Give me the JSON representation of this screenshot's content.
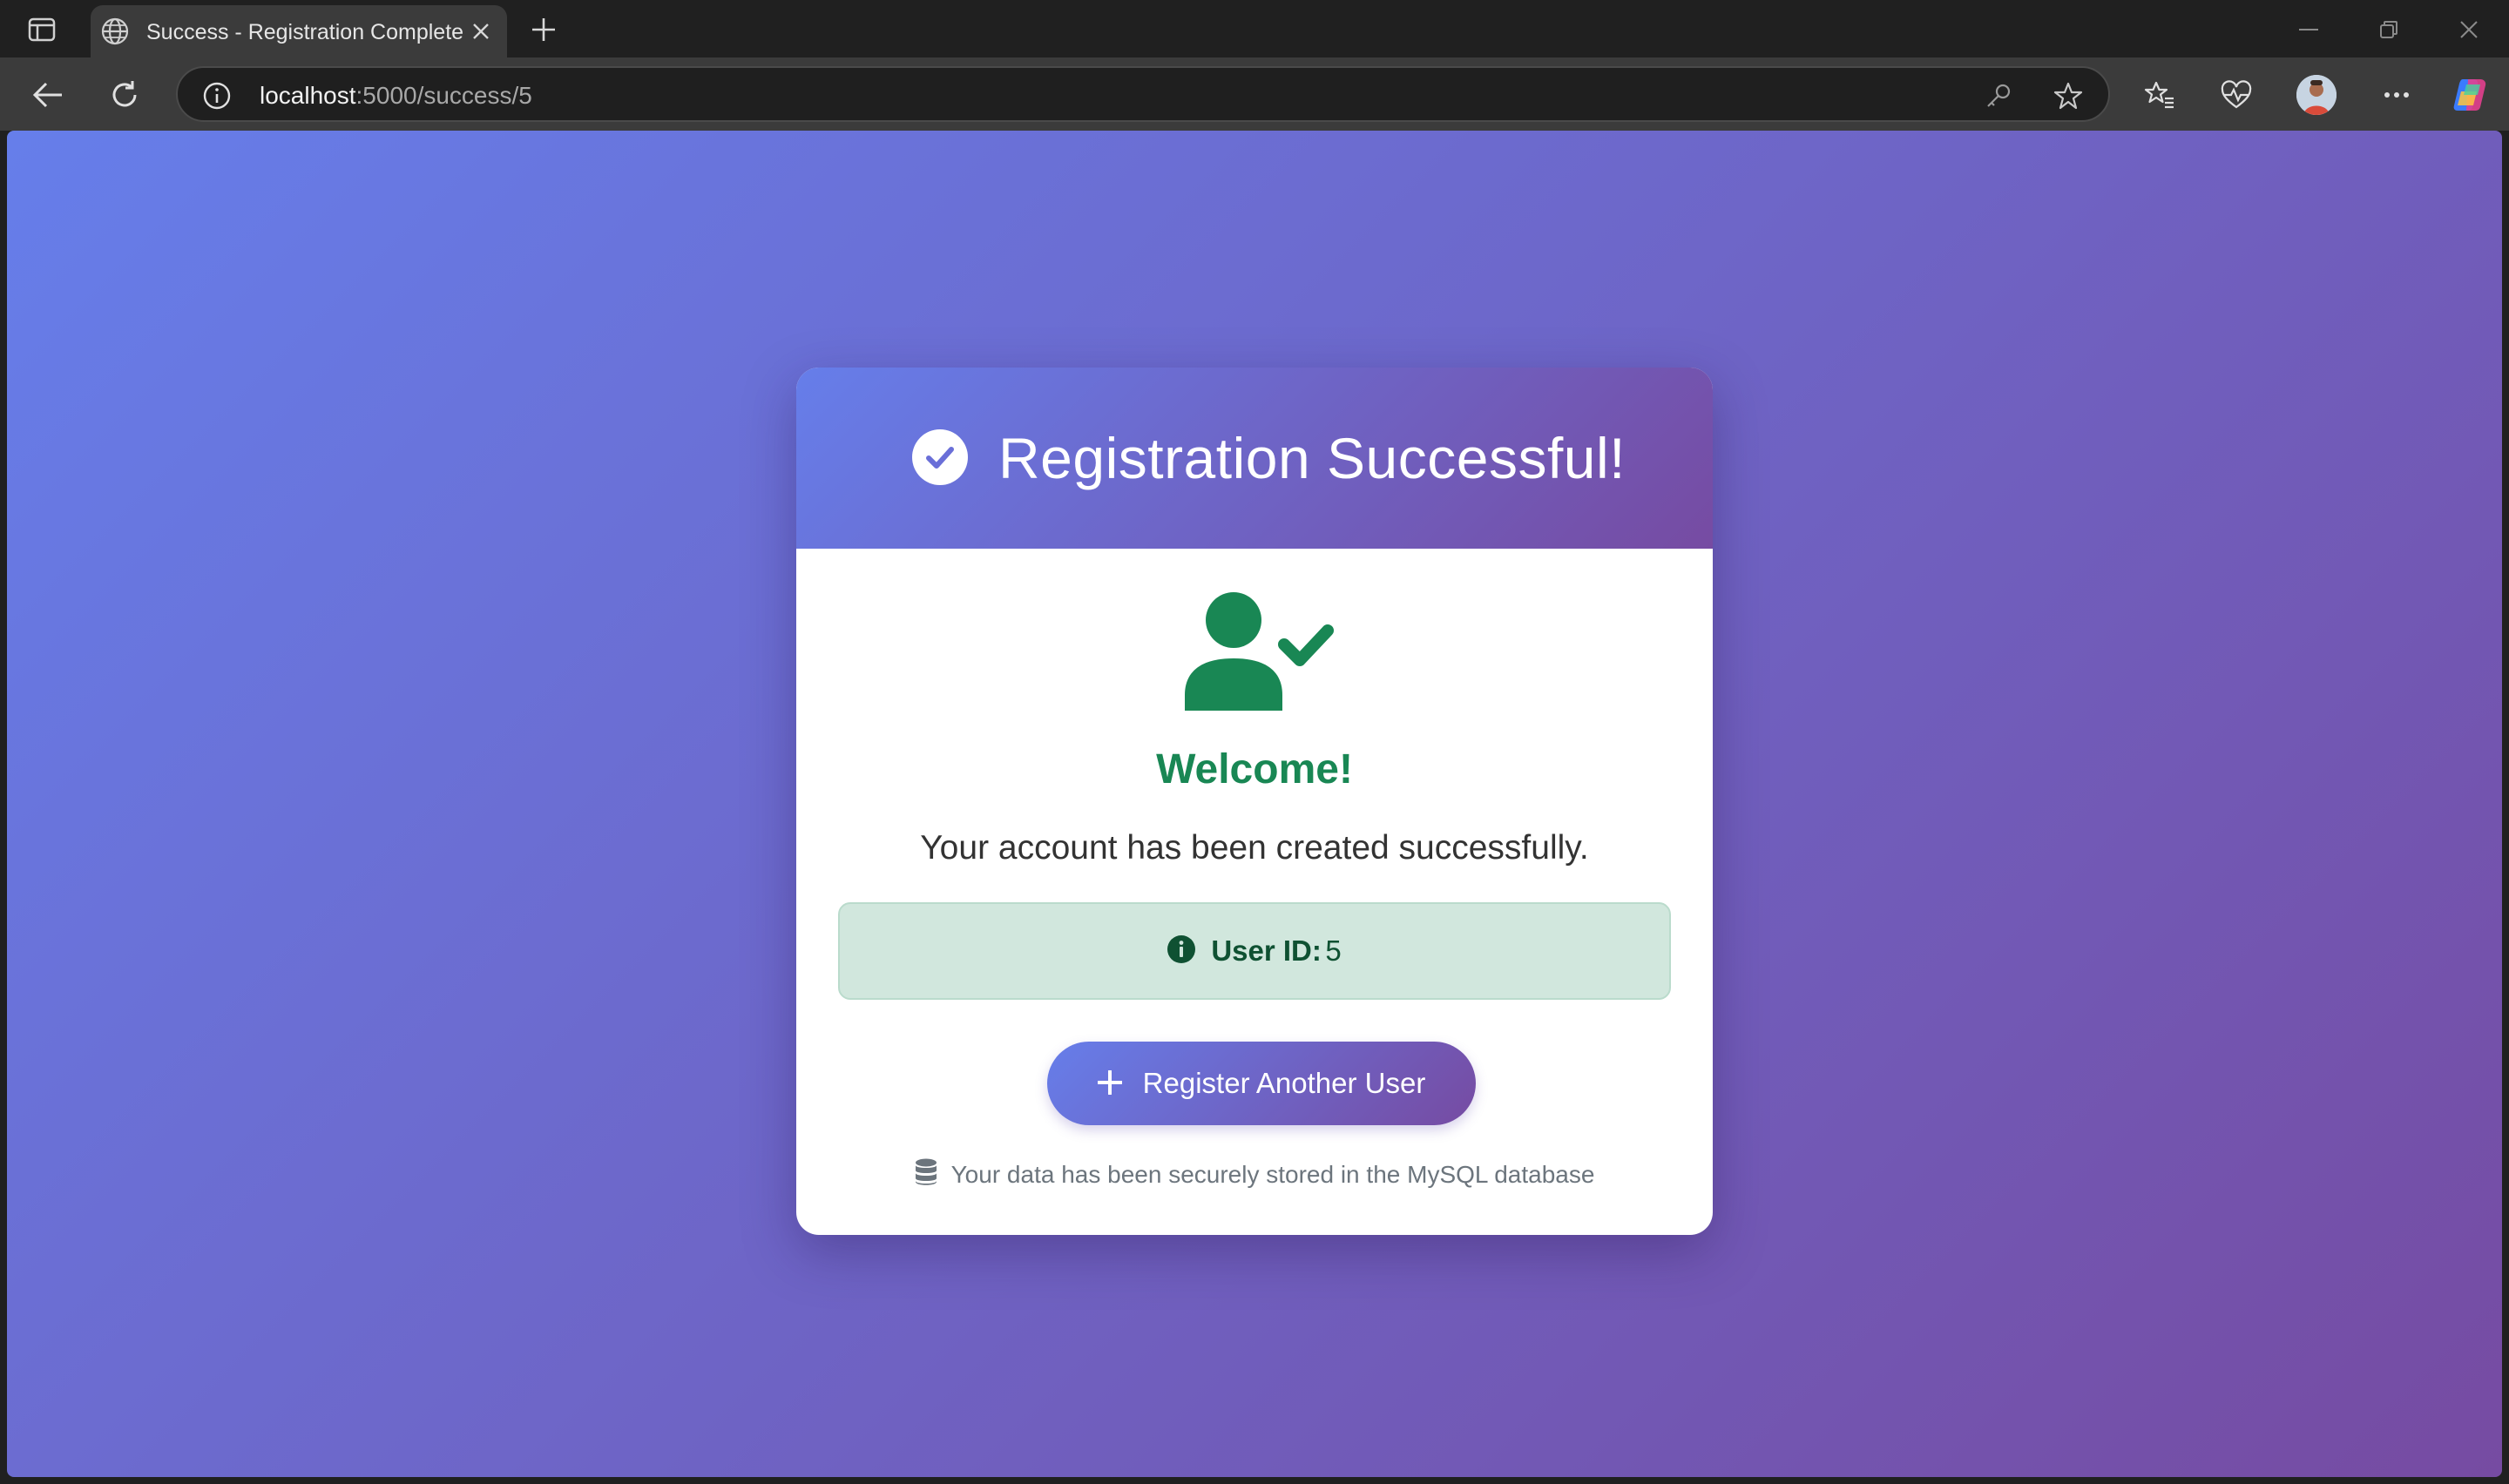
{
  "browser": {
    "tab_title": "Success - Registration Complete",
    "url_host": "localhost",
    "url_path": ":5000/success/5",
    "icons": [
      "sidebar-toggle-icon",
      "globe-icon",
      "close-icon",
      "plus-icon",
      "minimize-icon",
      "restore-icon",
      "window-close-icon",
      "back-arrow-icon",
      "refresh-icon",
      "info-icon",
      "key-icon",
      "star-icon",
      "favorites-icon",
      "heartbeat-icon",
      "avatar",
      "more-icon",
      "copilot-icon"
    ]
  },
  "page": {
    "background_gradient": [
      "#667eea",
      "#764ba2"
    ],
    "card": {
      "title": "Registration Successful!",
      "welcome": "Welcome!",
      "message": "Your account has been created successfully.",
      "user_id_label": "User ID:",
      "user_id_value": "5",
      "register_button": "Register Another User",
      "footnote": "Your data has been securely stored in the MySQL database"
    },
    "colors": {
      "success": "#198754",
      "alert_bg": "#d1e7dd",
      "alert_text": "#0f5132",
      "muted": "#6c757d"
    }
  }
}
